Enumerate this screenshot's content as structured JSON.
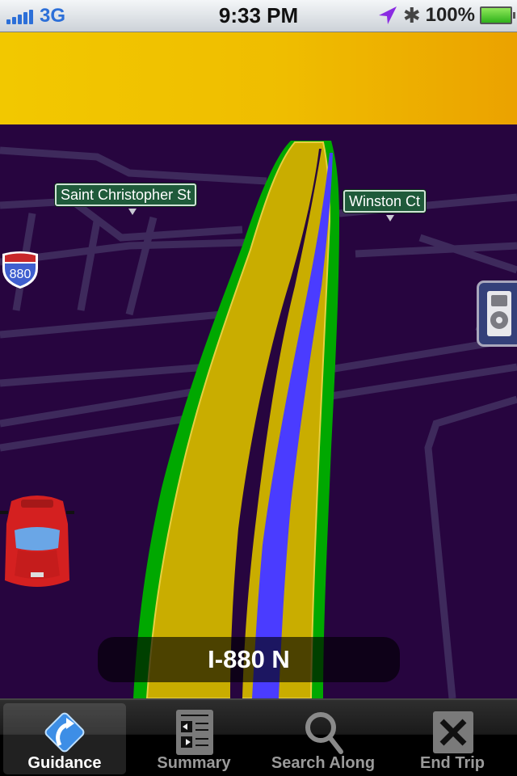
{
  "status_bar": {
    "carrier_signal_icon": "signal-bars-icon",
    "network": "3G",
    "time": "9:33 PM",
    "location_icon": "location-arrow-icon",
    "bluetooth_icon": "bluetooth-icon",
    "battery_percent": "100%",
    "battery_icon": "battery-full-icon"
  },
  "map": {
    "street_labels": [
      "Saint Christopher St",
      "Winston Ct"
    ],
    "highway_shield": "880",
    "current_road": "I-880 N",
    "colors": {
      "background": "#27053f",
      "route_blue": "#4a3cff",
      "road_yellow": "#c9ad00",
      "road_green": "#00a800",
      "sky": "#f0c000"
    }
  },
  "ipod_button": {
    "icon": "ipod-icon"
  },
  "tab_bar": {
    "tabs": [
      {
        "label": "Guidance",
        "icon": "guidance-turn-icon",
        "active": true
      },
      {
        "label": "Summary",
        "icon": "summary-list-icon",
        "active": false
      },
      {
        "label": "Search Along",
        "icon": "magnifier-icon",
        "active": false
      },
      {
        "label": "End Trip",
        "icon": "close-x-icon",
        "active": false
      }
    ]
  }
}
